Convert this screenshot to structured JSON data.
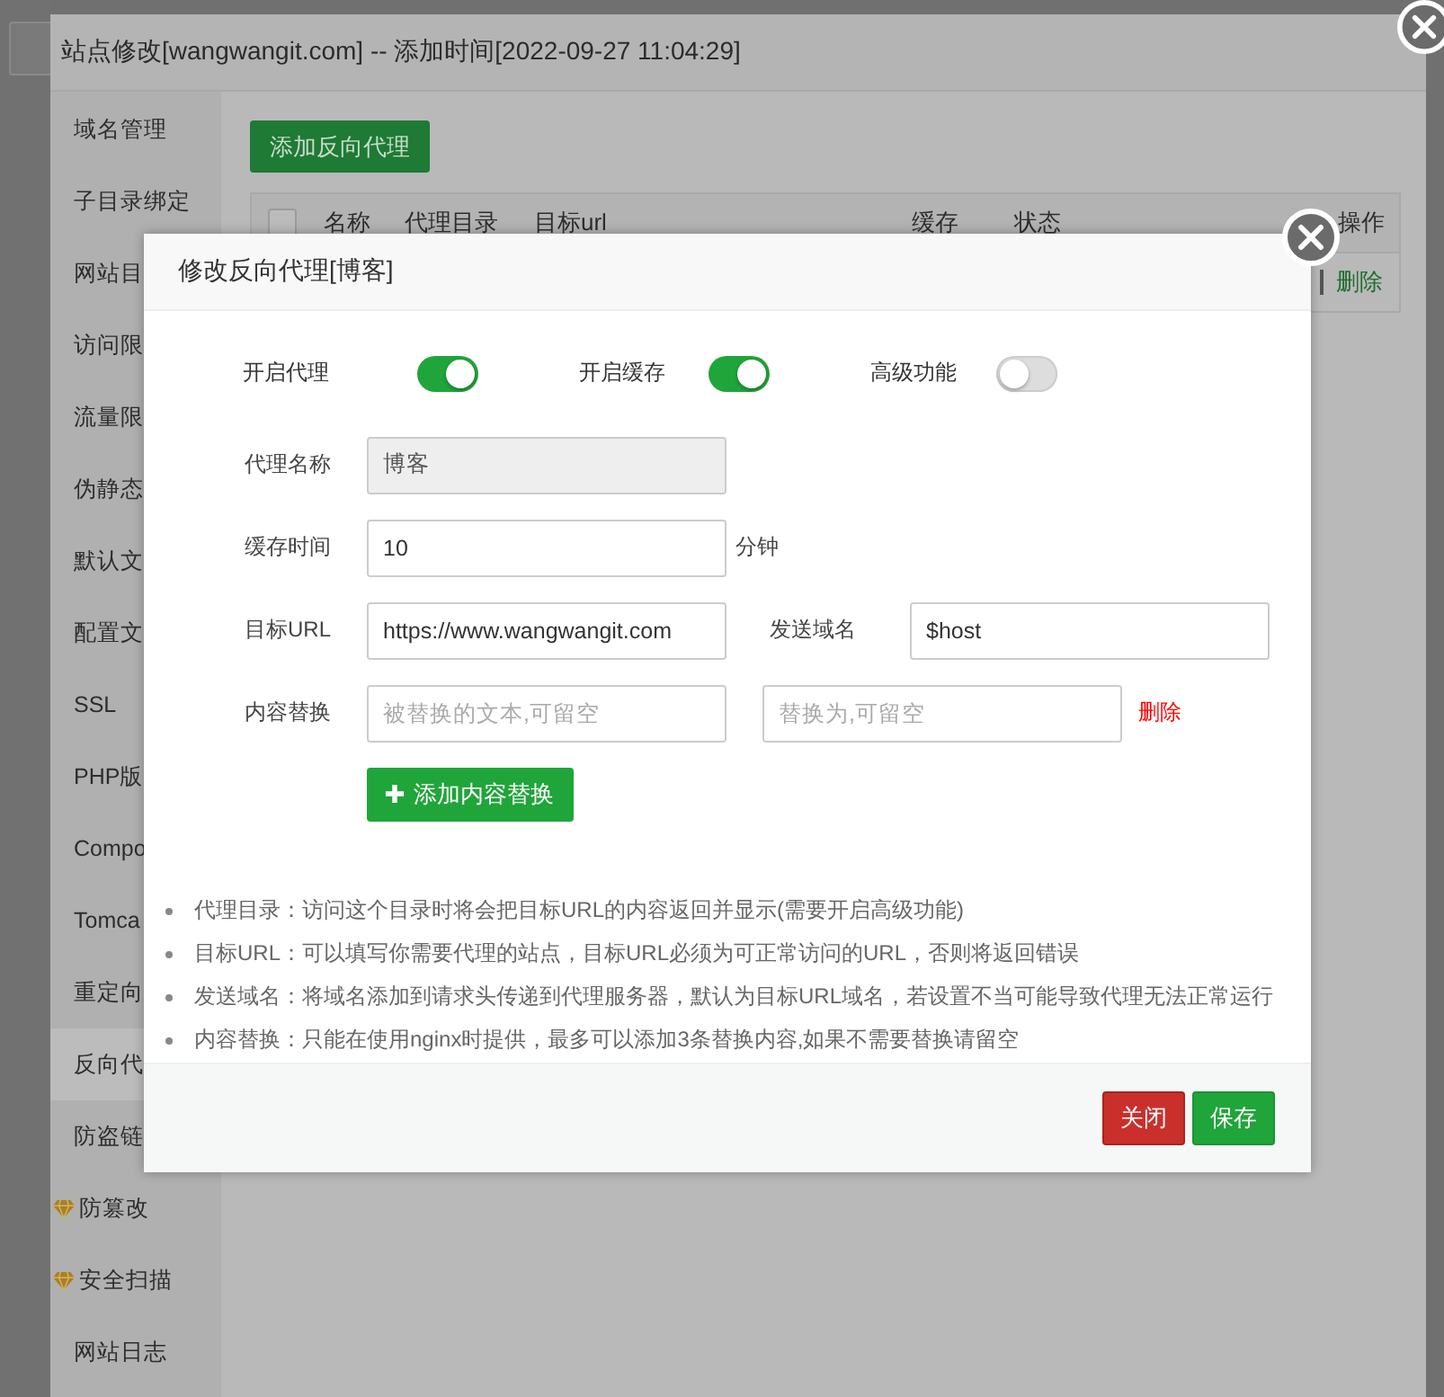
{
  "site_window": {
    "title": "站点修改[wangwangit.com] -- 添加时间[2022-09-27 11:04:29]"
  },
  "sidebar": {
    "items": [
      {
        "label": "域名管理",
        "selected": false,
        "kind": "plain"
      },
      {
        "label": "子目录绑定",
        "selected": false,
        "kind": "plain"
      },
      {
        "label": "网站目",
        "selected": false,
        "kind": "plain"
      },
      {
        "label": "访问限",
        "selected": false,
        "kind": "plain"
      },
      {
        "label": "流量限",
        "selected": false,
        "kind": "plain"
      },
      {
        "label": "伪静态",
        "selected": false,
        "kind": "plain"
      },
      {
        "label": "默认文",
        "selected": false,
        "kind": "plain"
      },
      {
        "label": "配置文",
        "selected": false,
        "kind": "plain"
      },
      {
        "label": "SSL",
        "selected": false,
        "kind": "plain"
      },
      {
        "label": "PHP版",
        "selected": false,
        "kind": "plain"
      },
      {
        "label": "Compo",
        "selected": false,
        "kind": "plain"
      },
      {
        "label": "Tomca",
        "selected": false,
        "kind": "plain"
      },
      {
        "label": "重定向",
        "selected": false,
        "kind": "plain"
      },
      {
        "label": "反向代",
        "selected": true,
        "kind": "plain"
      },
      {
        "label": "防盗链",
        "selected": false,
        "kind": "plain"
      },
      {
        "label": "防篡改",
        "selected": false,
        "kind": "gem"
      },
      {
        "label": "安全扫描",
        "selected": false,
        "kind": "gem"
      },
      {
        "label": "网站日志",
        "selected": false,
        "kind": "plain"
      }
    ]
  },
  "content": {
    "add_button": "添加反向代理",
    "table": {
      "header_checkbox": {
        "checked": false
      },
      "columns": [
        "名称",
        "代理目录",
        "目标url",
        "缓存",
        "状态",
        "操作"
      ],
      "rows": [
        {
          "action": "删除"
        }
      ]
    }
  },
  "dialog": {
    "title": "修改反向代理[博客]",
    "toggles": [
      {
        "label": "开启代理",
        "on": true
      },
      {
        "label": "开启缓存",
        "on": true
      },
      {
        "label": "高级功能",
        "on": false
      }
    ],
    "form_rows": [
      {
        "label": "代理名称",
        "fields": [
          {
            "value": "博客",
            "disabled": true
          }
        ]
      },
      {
        "label": "缓存时间",
        "fields": [
          {
            "value": "10",
            "disabled": false
          }
        ],
        "suffix": "分钟"
      },
      {
        "label": "目标URL",
        "fields": [
          {
            "value": "https://www.wangwangit.com",
            "disabled": false
          },
          {
            "label": "发送域名",
            "value": "$host",
            "disabled": false
          }
        ]
      },
      {
        "label": "内容替换",
        "fields": [
          {
            "placeholder": "被替换的文本,可留空",
            "disabled": false
          },
          {
            "placeholder": "替换为,可留空",
            "disabled": false
          }
        ],
        "delete_link": "删除"
      }
    ],
    "add_replace_button": "添加内容替换",
    "notes": [
      "代理目录：访问这个目录时将会把目标URL的内容返回并显示(需要开启高级功能)",
      "目标URL：可以填写你需要代理的站点，目标URL必须为可正常访问的URL，否则将返回错误",
      "发送域名：将域名添加到请求头传递到代理服务器，默认为目标URL域名，若设置不当可能导致代理无法正常运行",
      "内容替换：只能在使用nginx时提供，最多可以添加3条替换内容,如果不需要替换请留空"
    ],
    "buttons": [
      {
        "label": "关闭",
        "kind": "danger"
      },
      {
        "label": "保存",
        "kind": "primary"
      }
    ]
  }
}
